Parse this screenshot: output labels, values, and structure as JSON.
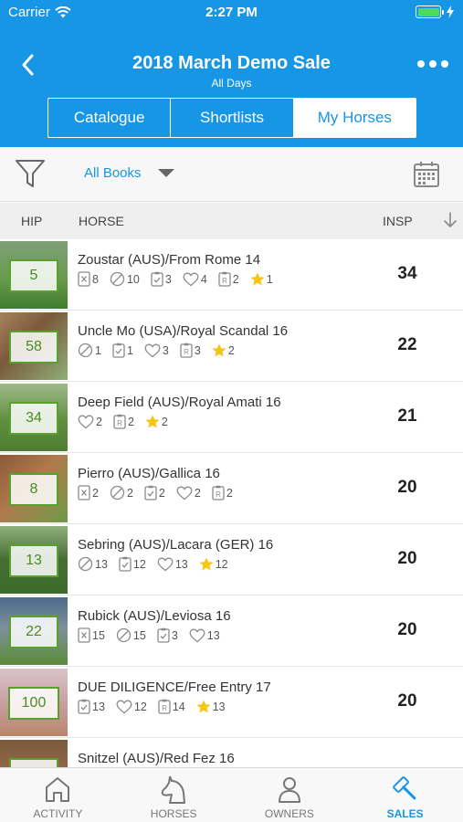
{
  "status_bar": {
    "carrier": "Carrier",
    "time": "2:27 PM"
  },
  "header": {
    "title": "2018 March Demo Sale",
    "subtitle": "All Days",
    "tabs": [
      {
        "label": "Catalogue",
        "active": false
      },
      {
        "label": "Shortlists",
        "active": false
      },
      {
        "label": "My Horses",
        "active": true
      }
    ]
  },
  "filter": {
    "books_label": "All Books"
  },
  "columns": {
    "hip": "HIP",
    "horse": "HORSE",
    "insp": "INSP"
  },
  "rows": [
    {
      "hip": "5",
      "name": "Zoustar (AUS)/From Rome 14",
      "stats": [
        {
          "icon": "xray-icon",
          "value": "8"
        },
        {
          "icon": "scope-icon",
          "value": "10"
        },
        {
          "icon": "checklist-icon",
          "value": "3"
        },
        {
          "icon": "heart-icon",
          "value": "4"
        },
        {
          "icon": "rating-icon",
          "value": "2"
        },
        {
          "icon": "star-icon",
          "value": "1"
        }
      ],
      "insp": "34"
    },
    {
      "hip": "58",
      "name": "Uncle Mo (USA)/Royal Scandal 16",
      "stats": [
        {
          "icon": "scope-icon",
          "value": "1"
        },
        {
          "icon": "checklist-icon",
          "value": "1"
        },
        {
          "icon": "heart-icon",
          "value": "3"
        },
        {
          "icon": "rating-icon",
          "value": "3"
        },
        {
          "icon": "star-icon",
          "value": "2"
        }
      ],
      "insp": "22"
    },
    {
      "hip": "34",
      "name": "Deep Field (AUS)/Royal Amati 16",
      "stats": [
        {
          "icon": "heart-icon",
          "value": "2"
        },
        {
          "icon": "rating-icon",
          "value": "2"
        },
        {
          "icon": "star-icon",
          "value": "2"
        }
      ],
      "insp": "21"
    },
    {
      "hip": "8",
      "name": "Pierro (AUS)/Gallica 16",
      "stats": [
        {
          "icon": "xray-icon",
          "value": "2"
        },
        {
          "icon": "scope-icon",
          "value": "2"
        },
        {
          "icon": "checklist-icon",
          "value": "2"
        },
        {
          "icon": "heart-icon",
          "value": "2"
        },
        {
          "icon": "rating-icon",
          "value": "2"
        }
      ],
      "insp": "20"
    },
    {
      "hip": "13",
      "name": "Sebring (AUS)/Lacara (GER) 16",
      "stats": [
        {
          "icon": "scope-icon",
          "value": "13"
        },
        {
          "icon": "checklist-icon",
          "value": "12"
        },
        {
          "icon": "heart-icon",
          "value": "13"
        },
        {
          "icon": "star-icon",
          "value": "12"
        }
      ],
      "insp": "20"
    },
    {
      "hip": "22",
      "name": "Rubick (AUS)/Leviosa 16",
      "stats": [
        {
          "icon": "xray-icon",
          "value": "15"
        },
        {
          "icon": "scope-icon",
          "value": "15"
        },
        {
          "icon": "checklist-icon",
          "value": "3"
        },
        {
          "icon": "heart-icon",
          "value": "13"
        }
      ],
      "insp": "20"
    },
    {
      "hip": "100",
      "name": "DUE DILIGENCE/Free Entry 17",
      "stats": [
        {
          "icon": "checklist-icon",
          "value": "13"
        },
        {
          "icon": "heart-icon",
          "value": "12"
        },
        {
          "icon": "rating-icon",
          "value": "14"
        },
        {
          "icon": "star-icon",
          "value": "13"
        }
      ],
      "insp": "20"
    },
    {
      "hip": "",
      "name": "Snitzel (AUS)/Red Fez 16",
      "stats": [],
      "insp": ""
    }
  ],
  "tabbar": [
    {
      "label": "ACTIVITY",
      "icon": "home-icon",
      "active": false
    },
    {
      "label": "HORSES",
      "icon": "horse-head-icon",
      "active": false
    },
    {
      "label": "OWNERS",
      "icon": "person-icon",
      "active": false
    },
    {
      "label": "SALES",
      "icon": "gavel-icon",
      "active": true
    }
  ],
  "colors": {
    "brand": "#1696e4",
    "hip_badge": "#5aa02c",
    "star": "#f5c518"
  }
}
